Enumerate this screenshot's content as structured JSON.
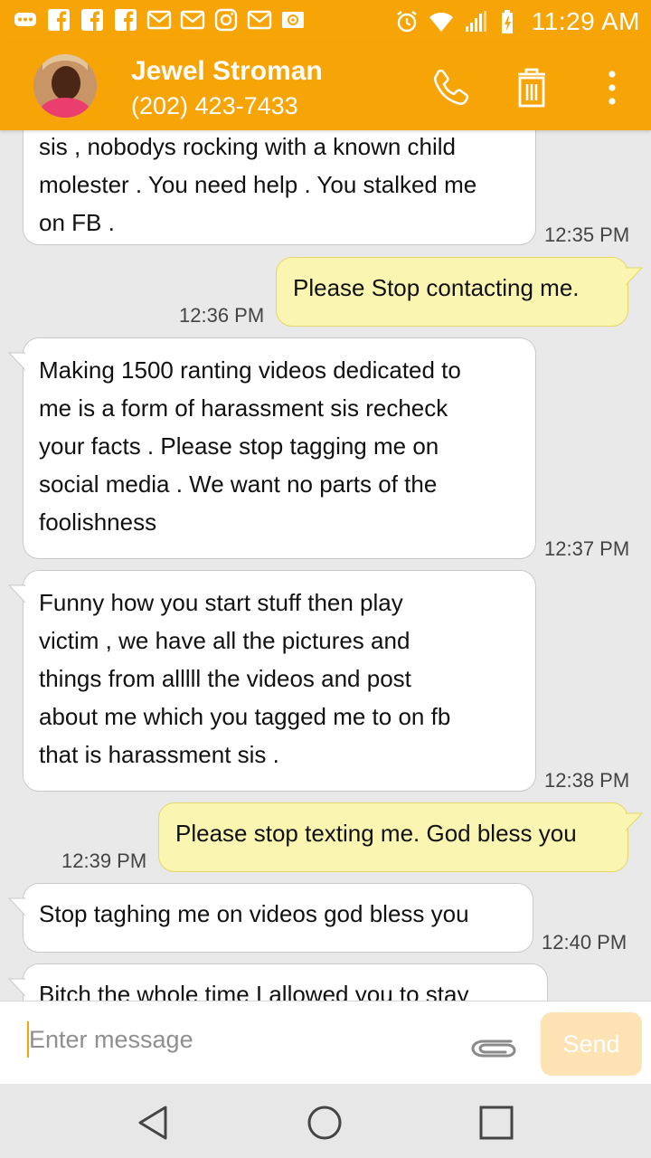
{
  "status_bar": {
    "time": "11:29 AM",
    "left_icons": [
      "chat-icon",
      "facebook-icon",
      "facebook-icon",
      "facebook-icon",
      "gmail-icon",
      "gmail-icon",
      "instagram-icon",
      "gmail-icon",
      "email-icon"
    ],
    "right_icons": [
      "alarm-icon",
      "wifi-icon",
      "signal-icon",
      "battery-charging-icon"
    ]
  },
  "header": {
    "contact_name": "Jewel Stroman",
    "contact_phone": "(202) 423-7433",
    "actions": [
      "phone-icon",
      "trash-icon",
      "more-vert-icon"
    ],
    "bg_color": "#f6a406"
  },
  "messages": [
    {
      "dir": "in",
      "lines": [
        "sis , nobodys rocking with a known child",
        "molester . You need help . You stalked me",
        "on FB ."
      ],
      "time": "12:35 PM"
    },
    {
      "dir": "out",
      "lines": [
        "Please Stop contacting me."
      ],
      "time": "12:36 PM"
    },
    {
      "dir": "in",
      "lines": [
        "Making 1500 ranting videos dedicated to",
        "me is a form of harassment sis recheck",
        "your facts . Please stop tagging me on",
        "social media . We want no parts of the",
        "foolishness"
      ],
      "time": "12:37 PM"
    },
    {
      "dir": "in",
      "lines": [
        "Funny how you start stuff then play",
        "victim , we have all the pictures and",
        "things from alllll the videos and post",
        "about me which you tagged me to on fb",
        "that is harassment sis ."
      ],
      "time": "12:38 PM"
    },
    {
      "dir": "out",
      "lines": [
        "Please stop texting me. God bless you"
      ],
      "time": "12:39 PM"
    },
    {
      "dir": "in",
      "lines": [
        "Stop taghing me on videos god bless you"
      ],
      "time": "12:40 PM"
    },
    {
      "dir": "in",
      "lines": [
        "Bitch the whole time I allowed you to stay"
      ],
      "time": ""
    }
  ],
  "compose": {
    "placeholder": "Enter message",
    "value": "",
    "send_label": "Send",
    "attach_icon": "paperclip-icon"
  },
  "nav_bar": [
    "back-icon",
    "home-icon",
    "recents-icon"
  ],
  "colors": {
    "accent": "#f6a406",
    "incoming_bubble": "#ffffff",
    "outgoing_bubble": "#fbf5b2",
    "send_disabled": "#fde3b4"
  }
}
